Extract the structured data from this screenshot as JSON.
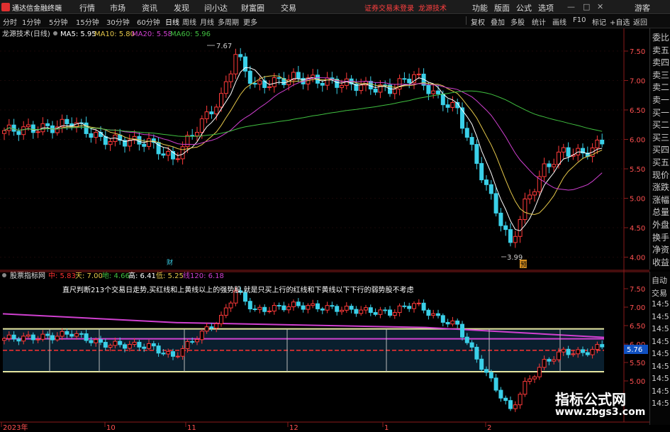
{
  "app": {
    "title": "通达信金融终端",
    "login": "证券交易未登录",
    "stock_name": "龙源技术",
    "guest": "游客"
  },
  "menu": [
    "行情",
    "市场",
    "资讯",
    "发现",
    "问小达",
    "财富圈",
    "交易"
  ],
  "menu_right": [
    "功能",
    "版面",
    "公式",
    "选项"
  ],
  "periods": [
    "分时",
    "1分钟",
    "5分钟",
    "15分钟",
    "30分钟",
    "60分钟",
    "日线",
    "周线",
    "月线",
    "多周期",
    "更多"
  ],
  "tools": [
    "复权",
    "叠加",
    "多股",
    "统计",
    "画线",
    "F10",
    "标记",
    "+自选",
    "返回"
  ],
  "main_chart": {
    "title": "龙源技术(日线)",
    "ma": [
      {
        "label": "MA5: 5.95",
        "color": "#ffffff"
      },
      {
        "label": "MA10: 5.80",
        "color": "#e6c84a"
      },
      {
        "label": "MA20: 5.58",
        "color": "#d040d0"
      },
      {
        "label": "MA60: 5.96",
        "color": "#40c040"
      }
    ],
    "yticks": [
      "7.50",
      "7.00",
      "6.50",
      "6.00",
      "5.50",
      "5.00",
      "4.50",
      "4.00"
    ],
    "high_label": "7.67",
    "low_label": "3.99",
    "cai_label": "财",
    "ban_label": "预"
  },
  "sub_chart": {
    "title": "股票指标网",
    "vals": [
      {
        "label": "中: 5.83",
        "color": "#ff3030"
      },
      {
        "label": "天: 7.00",
        "color": "#e6c84a"
      },
      {
        "label": "地: 4.66",
        "color": "#40c040"
      },
      {
        "label": "高: 6.41",
        "color": "#ffffff"
      },
      {
        "label": "低: 5.25",
        "color": "#e6c84a"
      },
      {
        "label": "线120: 6.18",
        "color": "#d040d0"
      }
    ],
    "note": "直尺判断213个交易日走势,买红线和上黄线以上的强势股,就是只买上行的红线和下黄线以下下行的弱势股不考虑",
    "yticks": [
      "7.50",
      "7.00",
      "6.50",
      "6.00",
      "5.50",
      "5.00"
    ],
    "price_tag": "5.76"
  },
  "xaxis": [
    "2023年",
    "10",
    "11",
    "12",
    "1",
    "2"
  ],
  "right_panel": [
    "委比",
    "卖五",
    "卖四",
    "卖三",
    "卖二",
    "卖一",
    "买一",
    "买二",
    "买三",
    "买四",
    "买五",
    "现价",
    "涨跌",
    "涨幅",
    "总量",
    "外盘",
    "换手",
    "净资",
    "收益"
  ],
  "right_panel2": [
    "自动",
    "交易",
    "14:5",
    "14:5",
    "14:5",
    "14:5",
    "14:5",
    "14:5",
    "14:5",
    "14:5",
    "14:5"
  ],
  "watermark": {
    "title": "指标公式网",
    "url": "www.zbgs3.com"
  },
  "colors": {
    "up": "#ff3a3a",
    "down": "#3ad0e8",
    "ma5": "#ffffff",
    "ma10": "#e6c84a",
    "ma20": "#d040d0",
    "ma60": "#40c040"
  }
}
